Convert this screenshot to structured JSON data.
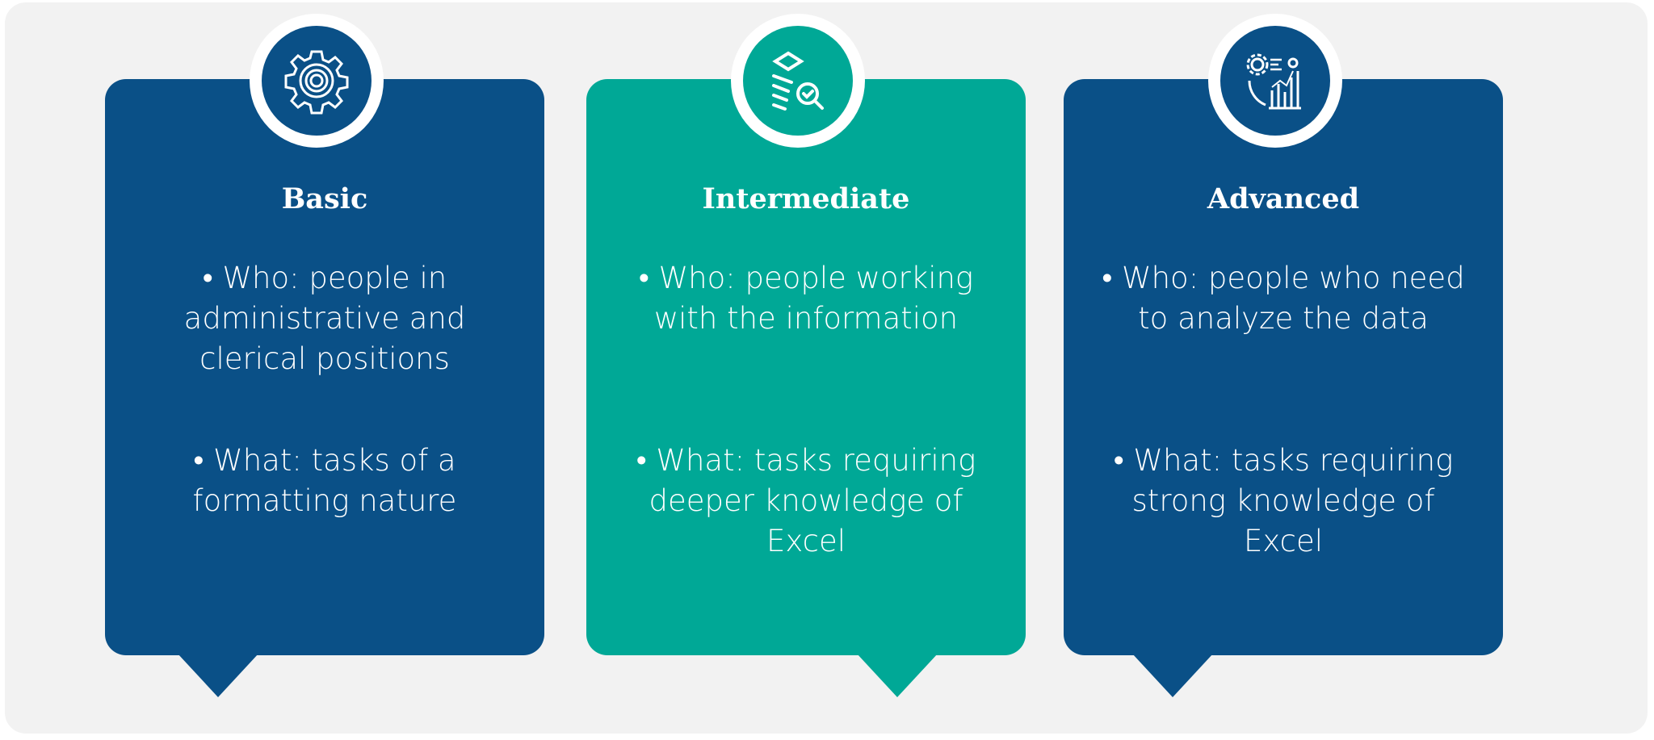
{
  "colors": {
    "blue": "#0a5087",
    "teal": "#00a896",
    "background": "#f2f2f2"
  },
  "cards": [
    {
      "title": "Basic",
      "icon": "gear-icon",
      "color": "#0a5087",
      "who": "• Who: people in administrative and clerical positions",
      "what": "• What: tasks of a formatting nature"
    },
    {
      "title": "Intermediate",
      "icon": "document-search-check-icon",
      "color": "#00a896",
      "who": "• Who: people working with the information",
      "what": "• What: tasks requiring deeper knowledge of Excel"
    },
    {
      "title": "Advanced",
      "icon": "analytics-chart-icon",
      "color": "#0a5087",
      "who": "• Who: people who need to analyze the data",
      "what": "• What: tasks requiring strong knowledge of Excel"
    }
  ]
}
